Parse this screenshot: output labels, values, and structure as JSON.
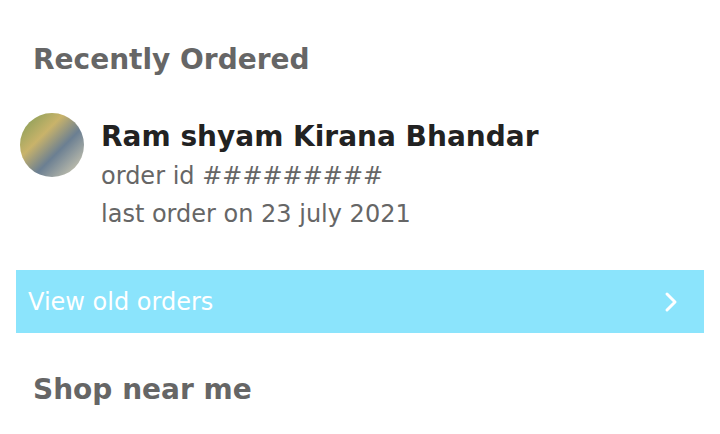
{
  "recent": {
    "title": "Recently Ordered",
    "shop": {
      "name": "Ram shyam Kirana Bhandar",
      "order_id": "order id #########",
      "last_order": "last order on 23 july 2021"
    },
    "view_old": {
      "label": "View old orders"
    }
  },
  "nearby": {
    "title": "Shop near me"
  }
}
